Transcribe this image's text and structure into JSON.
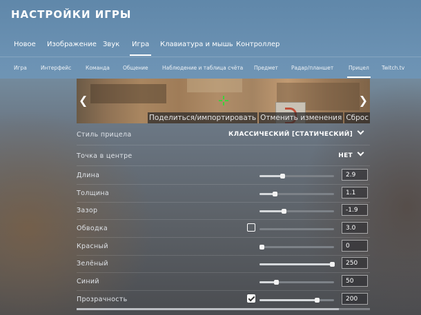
{
  "header": {
    "title": "НАСТРОЙКИ ИГРЫ"
  },
  "tabs": [
    {
      "label": "Новое"
    },
    {
      "label": "Изображение"
    },
    {
      "label": "Звук"
    },
    {
      "label": "Игра",
      "active": true
    },
    {
      "label": "Клавиатура и мышь"
    },
    {
      "label": "Контроллер"
    }
  ],
  "subtabs": [
    {
      "label": "Игра"
    },
    {
      "label": "Интерфейс"
    },
    {
      "label": "Команда"
    },
    {
      "label": "Общение"
    },
    {
      "label": "Наблюдение и таблица счёта"
    },
    {
      "label": "Предмет"
    },
    {
      "label": "Радар/планшет"
    },
    {
      "label": "Прицел",
      "active": true
    },
    {
      "label": "Twitch.tv"
    }
  ],
  "preview": {
    "prev_icon": "chevron-left-icon",
    "next_icon": "chevron-right-icon",
    "share_label": "Поделиться/импортировать",
    "revert_label": "Отменить изменения",
    "reset_label": "Сброс"
  },
  "settings": {
    "style": {
      "label": "Стиль прицела",
      "value": "КЛАССИЧЕСКИЙ [СТАТИЧЕСКИЙ]"
    },
    "center_dot": {
      "label": "Точка в центре",
      "value": "НЕТ"
    },
    "length": {
      "label": "Длина",
      "value": "2.9",
      "level": 0.31
    },
    "thickness": {
      "label": "Толщина",
      "value": "1.1",
      "level": 0.2
    },
    "gap": {
      "label": "Зазор",
      "value": "-1.9",
      "level": 0.32
    },
    "outline": {
      "label": "Обводка",
      "value": "3.0",
      "level": 0.0,
      "checked": false
    },
    "red": {
      "label": "Красный",
      "value": "0",
      "level": 0.03
    },
    "green": {
      "label": "Зелёный",
      "value": "250",
      "level": 0.97
    },
    "blue": {
      "label": "Синий",
      "value": "50",
      "level": 0.22
    },
    "alpha": {
      "label": "Прозрачность",
      "value": "200",
      "level": 0.77,
      "checked": true
    }
  },
  "colors": {
    "accent": "#ffffff",
    "crosshair": "#3cd23c",
    "header_bg": "#6e96b9"
  }
}
